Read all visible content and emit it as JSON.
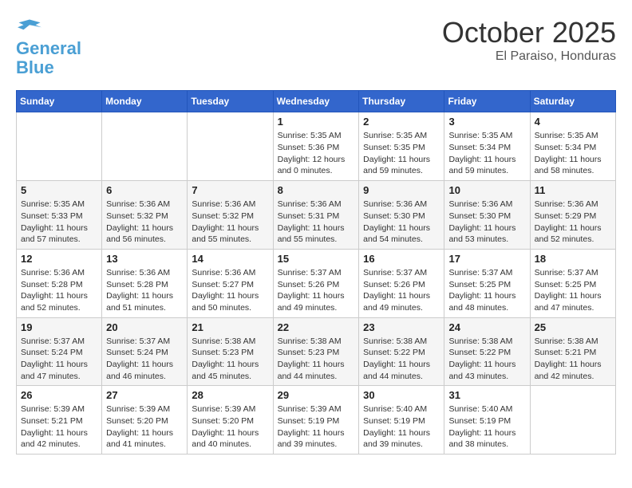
{
  "header": {
    "logo_line1": "General",
    "logo_line2": "Blue",
    "month": "October 2025",
    "location": "El Paraiso, Honduras"
  },
  "weekdays": [
    "Sunday",
    "Monday",
    "Tuesday",
    "Wednesday",
    "Thursday",
    "Friday",
    "Saturday"
  ],
  "weeks": [
    [
      {
        "day": "",
        "info": ""
      },
      {
        "day": "",
        "info": ""
      },
      {
        "day": "",
        "info": ""
      },
      {
        "day": "1",
        "info": "Sunrise: 5:35 AM\nSunset: 5:36 PM\nDaylight: 12 hours\nand 0 minutes."
      },
      {
        "day": "2",
        "info": "Sunrise: 5:35 AM\nSunset: 5:35 PM\nDaylight: 11 hours\nand 59 minutes."
      },
      {
        "day": "3",
        "info": "Sunrise: 5:35 AM\nSunset: 5:34 PM\nDaylight: 11 hours\nand 59 minutes."
      },
      {
        "day": "4",
        "info": "Sunrise: 5:35 AM\nSunset: 5:34 PM\nDaylight: 11 hours\nand 58 minutes."
      }
    ],
    [
      {
        "day": "5",
        "info": "Sunrise: 5:35 AM\nSunset: 5:33 PM\nDaylight: 11 hours\nand 57 minutes."
      },
      {
        "day": "6",
        "info": "Sunrise: 5:36 AM\nSunset: 5:32 PM\nDaylight: 11 hours\nand 56 minutes."
      },
      {
        "day": "7",
        "info": "Sunrise: 5:36 AM\nSunset: 5:32 PM\nDaylight: 11 hours\nand 55 minutes."
      },
      {
        "day": "8",
        "info": "Sunrise: 5:36 AM\nSunset: 5:31 PM\nDaylight: 11 hours\nand 55 minutes."
      },
      {
        "day": "9",
        "info": "Sunrise: 5:36 AM\nSunset: 5:30 PM\nDaylight: 11 hours\nand 54 minutes."
      },
      {
        "day": "10",
        "info": "Sunrise: 5:36 AM\nSunset: 5:30 PM\nDaylight: 11 hours\nand 53 minutes."
      },
      {
        "day": "11",
        "info": "Sunrise: 5:36 AM\nSunset: 5:29 PM\nDaylight: 11 hours\nand 52 minutes."
      }
    ],
    [
      {
        "day": "12",
        "info": "Sunrise: 5:36 AM\nSunset: 5:28 PM\nDaylight: 11 hours\nand 52 minutes."
      },
      {
        "day": "13",
        "info": "Sunrise: 5:36 AM\nSunset: 5:28 PM\nDaylight: 11 hours\nand 51 minutes."
      },
      {
        "day": "14",
        "info": "Sunrise: 5:36 AM\nSunset: 5:27 PM\nDaylight: 11 hours\nand 50 minutes."
      },
      {
        "day": "15",
        "info": "Sunrise: 5:37 AM\nSunset: 5:26 PM\nDaylight: 11 hours\nand 49 minutes."
      },
      {
        "day": "16",
        "info": "Sunrise: 5:37 AM\nSunset: 5:26 PM\nDaylight: 11 hours\nand 49 minutes."
      },
      {
        "day": "17",
        "info": "Sunrise: 5:37 AM\nSunset: 5:25 PM\nDaylight: 11 hours\nand 48 minutes."
      },
      {
        "day": "18",
        "info": "Sunrise: 5:37 AM\nSunset: 5:25 PM\nDaylight: 11 hours\nand 47 minutes."
      }
    ],
    [
      {
        "day": "19",
        "info": "Sunrise: 5:37 AM\nSunset: 5:24 PM\nDaylight: 11 hours\nand 47 minutes."
      },
      {
        "day": "20",
        "info": "Sunrise: 5:37 AM\nSunset: 5:24 PM\nDaylight: 11 hours\nand 46 minutes."
      },
      {
        "day": "21",
        "info": "Sunrise: 5:38 AM\nSunset: 5:23 PM\nDaylight: 11 hours\nand 45 minutes."
      },
      {
        "day": "22",
        "info": "Sunrise: 5:38 AM\nSunset: 5:23 PM\nDaylight: 11 hours\nand 44 minutes."
      },
      {
        "day": "23",
        "info": "Sunrise: 5:38 AM\nSunset: 5:22 PM\nDaylight: 11 hours\nand 44 minutes."
      },
      {
        "day": "24",
        "info": "Sunrise: 5:38 AM\nSunset: 5:22 PM\nDaylight: 11 hours\nand 43 minutes."
      },
      {
        "day": "25",
        "info": "Sunrise: 5:38 AM\nSunset: 5:21 PM\nDaylight: 11 hours\nand 42 minutes."
      }
    ],
    [
      {
        "day": "26",
        "info": "Sunrise: 5:39 AM\nSunset: 5:21 PM\nDaylight: 11 hours\nand 42 minutes."
      },
      {
        "day": "27",
        "info": "Sunrise: 5:39 AM\nSunset: 5:20 PM\nDaylight: 11 hours\nand 41 minutes."
      },
      {
        "day": "28",
        "info": "Sunrise: 5:39 AM\nSunset: 5:20 PM\nDaylight: 11 hours\nand 40 minutes."
      },
      {
        "day": "29",
        "info": "Sunrise: 5:39 AM\nSunset: 5:19 PM\nDaylight: 11 hours\nand 39 minutes."
      },
      {
        "day": "30",
        "info": "Sunrise: 5:40 AM\nSunset: 5:19 PM\nDaylight: 11 hours\nand 39 minutes."
      },
      {
        "day": "31",
        "info": "Sunrise: 5:40 AM\nSunset: 5:19 PM\nDaylight: 11 hours\nand 38 minutes."
      },
      {
        "day": "",
        "info": ""
      }
    ]
  ]
}
